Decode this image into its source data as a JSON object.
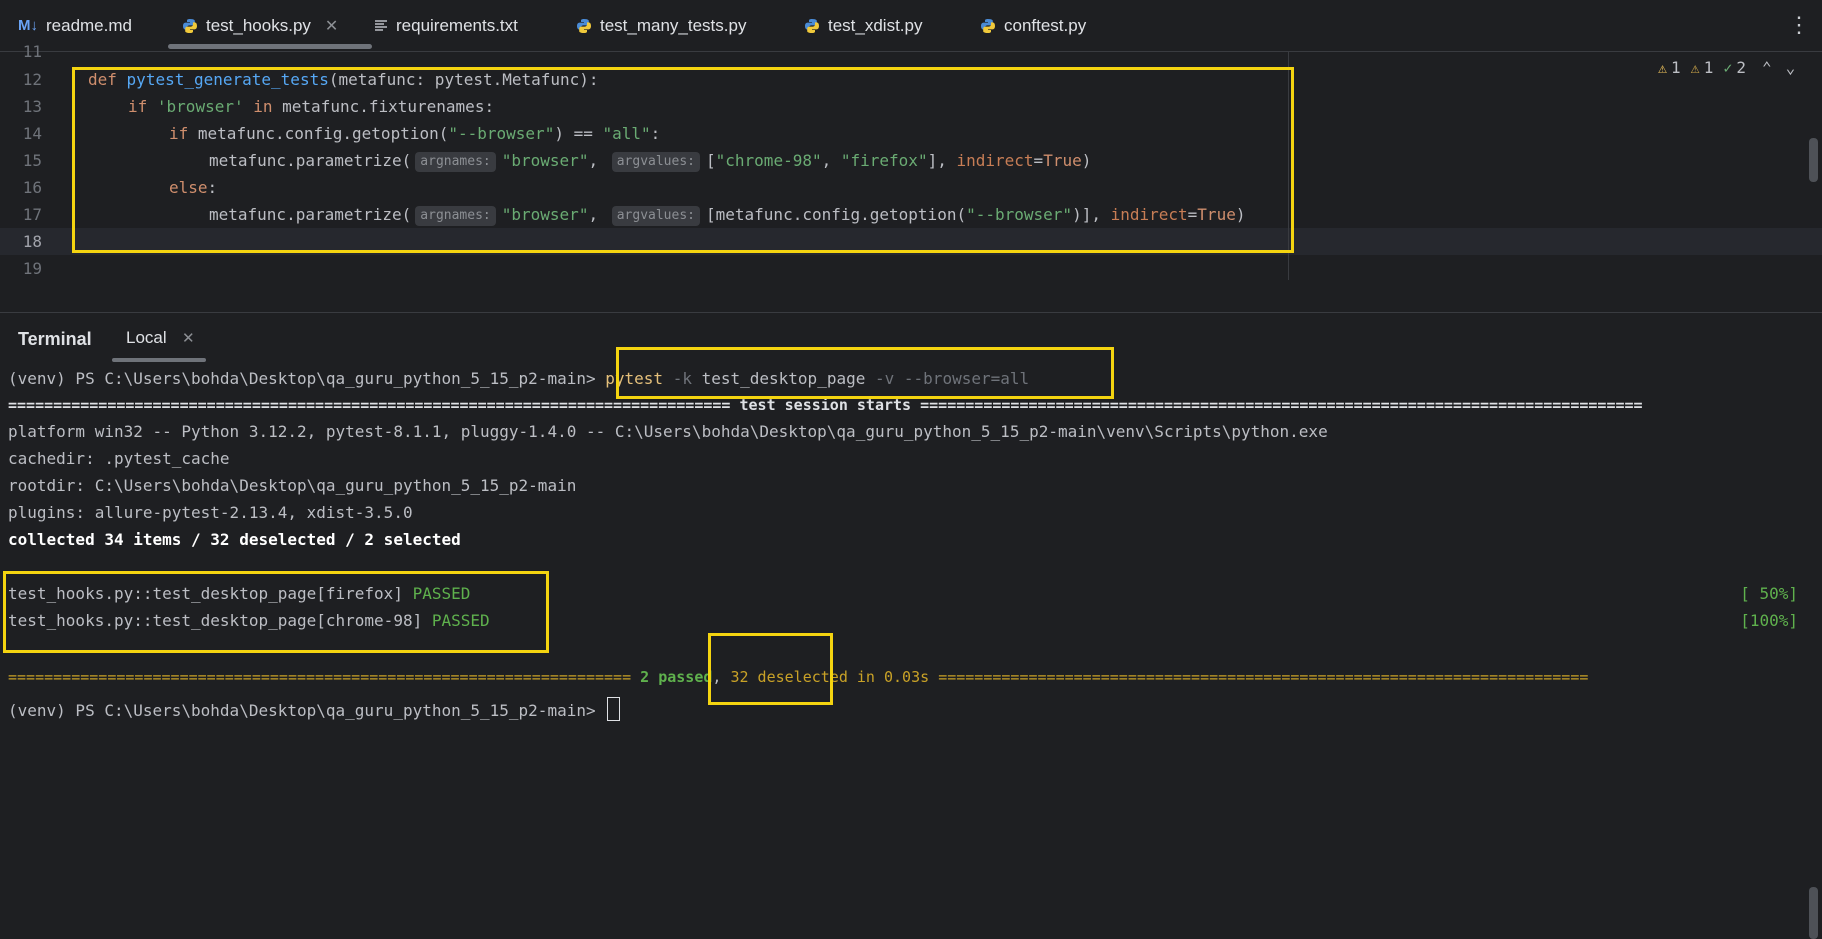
{
  "tabs": [
    {
      "label": "readme.md",
      "icon": "markdown-icon"
    },
    {
      "label": "test_hooks.py",
      "icon": "python-icon",
      "active": true,
      "closable": true
    },
    {
      "label": "requirements.txt",
      "icon": "text-file-icon"
    },
    {
      "label": "test_many_tests.py",
      "icon": "python-icon"
    },
    {
      "label": "test_xdist.py",
      "icon": "python-icon"
    },
    {
      "label": "conftest.py",
      "icon": "python-icon"
    }
  ],
  "markdown_badge": "M↓",
  "editor": {
    "line_numbers": [
      "11",
      "12",
      "13",
      "14",
      "15",
      "16",
      "17",
      "18",
      "19"
    ],
    "current_line": "18",
    "line12": {
      "kw": "def",
      "fn": "pytest_generate_tests",
      "rest": "(metafunc: pytest.Metafunc):"
    },
    "line13": {
      "kw_if": "if",
      "str": "'browser'",
      "kw_in": "in",
      "rest": "metafunc.fixturenames:"
    },
    "line14": {
      "kw_if": "if",
      "pre": "metafunc.config.getoption(",
      "str1": "\"--browser\"",
      "mid": ") == ",
      "str2": "\"all\"",
      "post": ":"
    },
    "line15": {
      "pre": "metafunc.parametrize(",
      "hint1": "argnames:",
      "str1": "\"browser\"",
      "comma": ", ",
      "hint2": "argvalues:",
      "lb": "[",
      "str2": "\"chrome-98\"",
      "c2": ", ",
      "str3": "\"firefox\"",
      "rb": "], ",
      "param": "indirect",
      "eq": "=",
      "kw": "True",
      "close": ")"
    },
    "line16": {
      "kw": "else",
      "post": ":"
    },
    "line17": {
      "pre": "metafunc.parametrize(",
      "hint1": "argnames:",
      "str1": "\"browser\"",
      "comma": ", ",
      "hint2": "argvalues:",
      "mid": "[metafunc.config.getoption(",
      "str2": "\"--browser\"",
      "rb": ")], ",
      "param": "indirect",
      "eq": "=",
      "kw": "True",
      "close": ")"
    }
  },
  "inspections": {
    "warnings": "1",
    "weak_warnings": "1",
    "typos": "2"
  },
  "terminal": {
    "title": "Terminal",
    "tab": "Local",
    "prompt": "(venv) PS C:\\Users\\bohda\\Desktop\\qa_guru_python_5_15_p2-main>",
    "command": {
      "pytest": "pytest",
      "k": "-k",
      "name": "test_desktop_page",
      "v": "-v",
      "browser": "--browser=all"
    },
    "session_header": "================================================================================ test session starts ================================================================================",
    "platform": "platform win32 -- Python 3.12.2, pytest-8.1.1, pluggy-1.4.0 -- C:\\Users\\bohda\\Desktop\\qa_guru_python_5_15_p2-main\\venv\\Scripts\\python.exe",
    "cachedir": "cachedir: .pytest_cache",
    "rootdir": "rootdir: C:\\Users\\bohda\\Desktop\\qa_guru_python_5_15_p2-main",
    "plugins": "plugins: allure-pytest-2.13.4, xdist-3.5.0",
    "collected": "collected 34 items / 32 deselected / 2 selected",
    "results": [
      {
        "test": "test_hooks.py::test_desktop_page[firefox]",
        "status": "PASSED",
        "progress": "[ 50%]"
      },
      {
        "test": "test_hooks.py::test_desktop_page[chrome-98]",
        "status": "PASSED",
        "progress": "[100%]"
      }
    ],
    "summary": {
      "left_rule": "===================================================================== ",
      "passed": "2 passed",
      "comma": ",",
      "rest": " 32 deselected in 0.03s ",
      "right_rule": "========================================================================"
    },
    "final_prompt": "(venv) PS C:\\Users\\bohda\\Desktop\\qa_guru_python_5_15_p2-main>"
  },
  "colors": {
    "highlight": "#f4d410",
    "pass": "#5fb14d",
    "keyword": "#cf8e6d",
    "function": "#56a8f5",
    "string": "#6aab73"
  }
}
